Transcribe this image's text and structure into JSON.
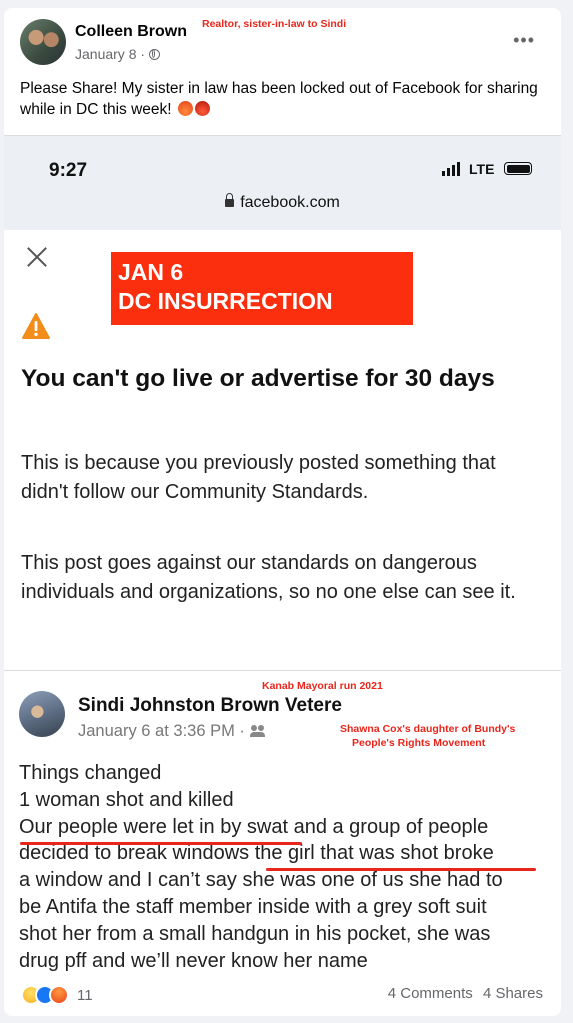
{
  "header": {
    "author": "Colleen Brown",
    "date": "January 8 · ",
    "annotation": "Realtor, sister-in-law to Sindi",
    "more": "•••"
  },
  "post_text": "Please Share! My sister in law has been locked out of Facebook for sharing while in DC this week!",
  "screenshot": {
    "time": "9:27",
    "network": "LTE",
    "url": "facebook.com",
    "stamp_line1": "JAN 6",
    "stamp_line2": "DC INSURRECTION",
    "heading": "You can't go live or advertise for 30 days",
    "para1": "This is because you previously posted something that didn't follow our Community Standards.",
    "para2": "This post goes against our standards on dangerous individuals and organizations, so no one else can see it."
  },
  "shared": {
    "annotation_top": "Kanab Mayoral run 2021",
    "author": "Sindi Johnston Brown Vetere",
    "date": "January 6 at 3:36 PM · ",
    "annotation_line1": "Shawna Cox's daughter of Bundy's",
    "annotation_line2": "People's Rights Movement",
    "lines": [
      "Things changed",
      "1 woman shot and killed",
      "Our people were let in by swat and a group of people",
      "decided to break windows the girl that was shot broke",
      "a window and I can’t say she was one of us she had to",
      "be Antifa the staff member inside with a grey soft suit",
      "shot her from a small handgun in his pocket, she was",
      "drug pff and we’ll never know her name"
    ]
  },
  "footer": {
    "reaction_count": "11",
    "comments": "4 Comments",
    "shares": "4 Shares"
  },
  "colors": {
    "annotation_red": "#e8261c",
    "stamp_red": "#fb2e0e"
  }
}
